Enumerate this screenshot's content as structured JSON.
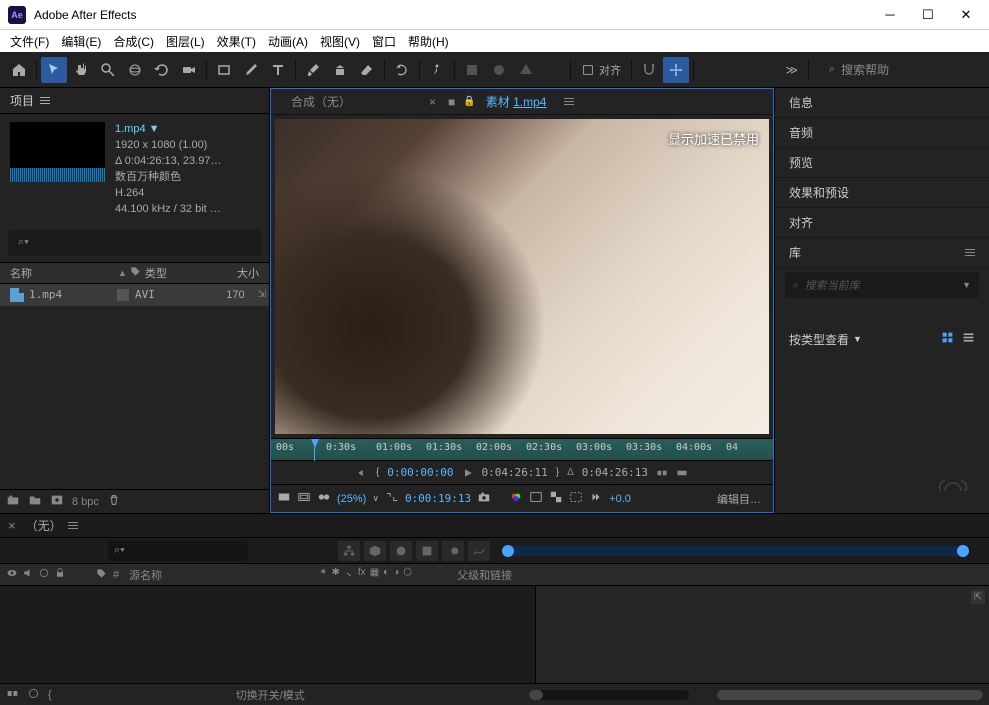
{
  "app": {
    "title": "Adobe After Effects"
  },
  "menu": [
    "文件(F)",
    "编辑(E)",
    "合成(C)",
    "图层(L)",
    "效果(T)",
    "动画(A)",
    "视图(V)",
    "窗口",
    "帮助(H)"
  ],
  "toolbar": {
    "align": "对齐",
    "search_help": "搜索帮助"
  },
  "project": {
    "title": "项目",
    "file": {
      "name": "1.mp4 ▼",
      "dims": "1920 x 1080 (1.00)",
      "dur": "Δ 0:04:26:13, 23.97…",
      "colors": "数百万种颜色",
      "codec": "H.264",
      "audio": "44.100 kHz / 32 bit …"
    },
    "cols": {
      "name": "名称",
      "type": "类型",
      "size": "大小"
    },
    "row": {
      "name": "1.mp4",
      "type": "AVI",
      "size": "170"
    },
    "bpc": "8 bpc"
  },
  "viewer": {
    "tab_comp": "合成（无）",
    "tab_footage_label": "素材",
    "tab_footage_name": "1.mp4",
    "overlay": "显示加速已禁用",
    "ruler": [
      "00s",
      "0:30s",
      "01:00s",
      "01:30s",
      "02:00s",
      "02:30s",
      "03:00s",
      "03:30s",
      "04:00s",
      "04"
    ],
    "time": {
      "start": "0:00:00:00",
      "end": "0:04:26:11",
      "dur": "0:04:26:13"
    },
    "footer": {
      "zoom": "(25%)",
      "timecode": "0:00:19:13",
      "plus": "+0.0",
      "edit": "编辑目…"
    }
  },
  "right": {
    "info": "信息",
    "audio": "音频",
    "preview": "预览",
    "effects": "效果和预设",
    "align": "对齐",
    "library": "库",
    "libsearch": "搜索当前库",
    "viewby": "按类型查看"
  },
  "timeline": {
    "title": "（无）",
    "cols": {
      "src": "源名称",
      "parent": "父级和链接"
    },
    "toggle": "切换开关/模式"
  }
}
